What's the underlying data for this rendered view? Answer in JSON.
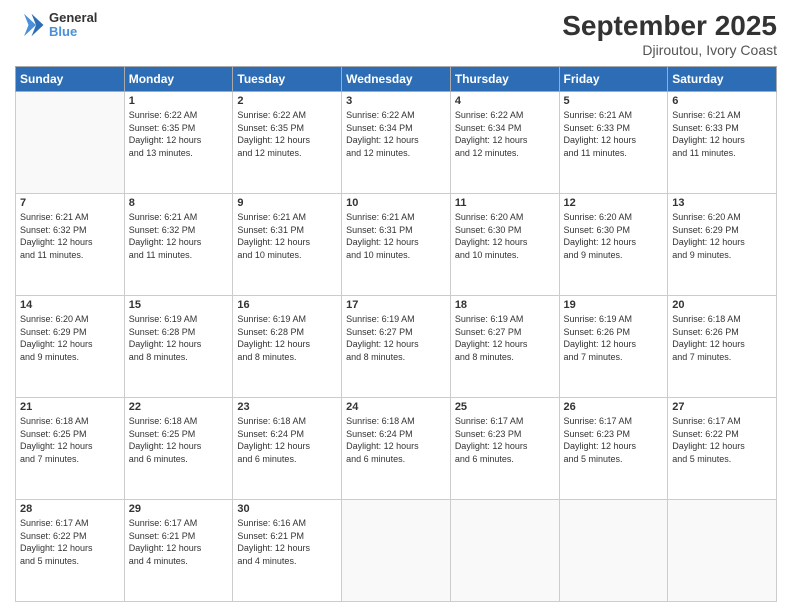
{
  "logo": {
    "line1": "General",
    "line2": "Blue"
  },
  "title": "September 2025",
  "subtitle": "Djiroutou, Ivory Coast",
  "days_of_week": [
    "Sunday",
    "Monday",
    "Tuesday",
    "Wednesday",
    "Thursday",
    "Friday",
    "Saturday"
  ],
  "weeks": [
    [
      {
        "day": "",
        "content": ""
      },
      {
        "day": "1",
        "sunrise": "6:22 AM",
        "sunset": "6:35 PM",
        "daylight": "12 hours and 13 minutes."
      },
      {
        "day": "2",
        "sunrise": "6:22 AM",
        "sunset": "6:35 PM",
        "daylight": "12 hours and 12 minutes."
      },
      {
        "day": "3",
        "sunrise": "6:22 AM",
        "sunset": "6:34 PM",
        "daylight": "12 hours and 12 minutes."
      },
      {
        "day": "4",
        "sunrise": "6:22 AM",
        "sunset": "6:34 PM",
        "daylight": "12 hours and 12 minutes."
      },
      {
        "day": "5",
        "sunrise": "6:21 AM",
        "sunset": "6:33 PM",
        "daylight": "12 hours and 11 minutes."
      },
      {
        "day": "6",
        "sunrise": "6:21 AM",
        "sunset": "6:33 PM",
        "daylight": "12 hours and 11 minutes."
      }
    ],
    [
      {
        "day": "7",
        "sunrise": "6:21 AM",
        "sunset": "6:32 PM",
        "daylight": "12 hours and 11 minutes."
      },
      {
        "day": "8",
        "sunrise": "6:21 AM",
        "sunset": "6:32 PM",
        "daylight": "12 hours and 11 minutes."
      },
      {
        "day": "9",
        "sunrise": "6:21 AM",
        "sunset": "6:31 PM",
        "daylight": "12 hours and 10 minutes."
      },
      {
        "day": "10",
        "sunrise": "6:21 AM",
        "sunset": "6:31 PM",
        "daylight": "12 hours and 10 minutes."
      },
      {
        "day": "11",
        "sunrise": "6:20 AM",
        "sunset": "6:30 PM",
        "daylight": "12 hours and 10 minutes."
      },
      {
        "day": "12",
        "sunrise": "6:20 AM",
        "sunset": "6:30 PM",
        "daylight": "12 hours and 9 minutes."
      },
      {
        "day": "13",
        "sunrise": "6:20 AM",
        "sunset": "6:29 PM",
        "daylight": "12 hours and 9 minutes."
      }
    ],
    [
      {
        "day": "14",
        "sunrise": "6:20 AM",
        "sunset": "6:29 PM",
        "daylight": "12 hours and 9 minutes."
      },
      {
        "day": "15",
        "sunrise": "6:19 AM",
        "sunset": "6:28 PM",
        "daylight": "12 hours and 8 minutes."
      },
      {
        "day": "16",
        "sunrise": "6:19 AM",
        "sunset": "6:28 PM",
        "daylight": "12 hours and 8 minutes."
      },
      {
        "day": "17",
        "sunrise": "6:19 AM",
        "sunset": "6:27 PM",
        "daylight": "12 hours and 8 minutes."
      },
      {
        "day": "18",
        "sunrise": "6:19 AM",
        "sunset": "6:27 PM",
        "daylight": "12 hours and 8 minutes."
      },
      {
        "day": "19",
        "sunrise": "6:19 AM",
        "sunset": "6:26 PM",
        "daylight": "12 hours and 7 minutes."
      },
      {
        "day": "20",
        "sunrise": "6:18 AM",
        "sunset": "6:26 PM",
        "daylight": "12 hours and 7 minutes."
      }
    ],
    [
      {
        "day": "21",
        "sunrise": "6:18 AM",
        "sunset": "6:25 PM",
        "daylight": "12 hours and 7 minutes."
      },
      {
        "day": "22",
        "sunrise": "6:18 AM",
        "sunset": "6:25 PM",
        "daylight": "12 hours and 6 minutes."
      },
      {
        "day": "23",
        "sunrise": "6:18 AM",
        "sunset": "6:24 PM",
        "daylight": "12 hours and 6 minutes."
      },
      {
        "day": "24",
        "sunrise": "6:18 AM",
        "sunset": "6:24 PM",
        "daylight": "12 hours and 6 minutes."
      },
      {
        "day": "25",
        "sunrise": "6:17 AM",
        "sunset": "6:23 PM",
        "daylight": "12 hours and 6 minutes."
      },
      {
        "day": "26",
        "sunrise": "6:17 AM",
        "sunset": "6:23 PM",
        "daylight": "12 hours and 5 minutes."
      },
      {
        "day": "27",
        "sunrise": "6:17 AM",
        "sunset": "6:22 PM",
        "daylight": "12 hours and 5 minutes."
      }
    ],
    [
      {
        "day": "28",
        "sunrise": "6:17 AM",
        "sunset": "6:22 PM",
        "daylight": "12 hours and 5 minutes."
      },
      {
        "day": "29",
        "sunrise": "6:17 AM",
        "sunset": "6:21 PM",
        "daylight": "12 hours and 4 minutes."
      },
      {
        "day": "30",
        "sunrise": "6:16 AM",
        "sunset": "6:21 PM",
        "daylight": "12 hours and 4 minutes."
      },
      {
        "day": "",
        "content": ""
      },
      {
        "day": "",
        "content": ""
      },
      {
        "day": "",
        "content": ""
      },
      {
        "day": "",
        "content": ""
      }
    ]
  ]
}
